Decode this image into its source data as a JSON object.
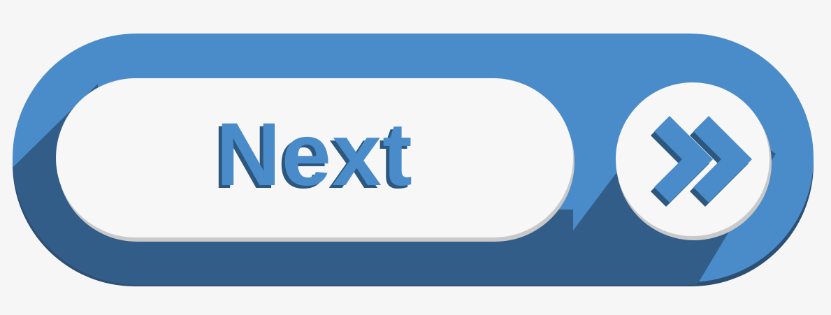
{
  "button": {
    "label": "Next",
    "arrow_icon": "double-chevron-right-icon"
  },
  "colors": {
    "primary_blue": "#4a8cc9",
    "dark_blue": "#325d88",
    "shadow_blue": "#2c4f72",
    "white": "#f7f7f7",
    "background": "#f6f6f6"
  }
}
